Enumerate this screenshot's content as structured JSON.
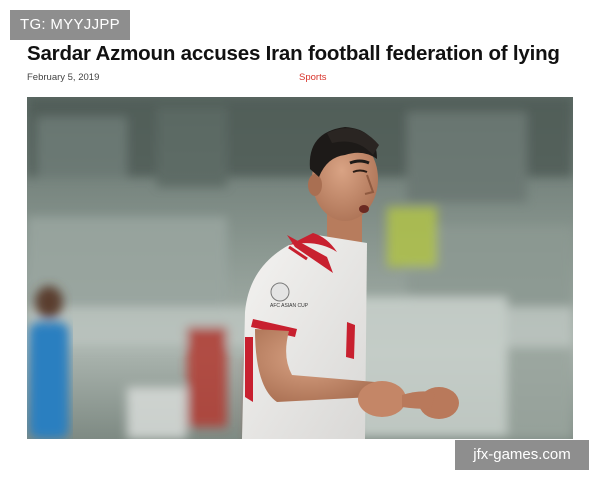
{
  "tag": "TG: MYYJJPP",
  "article": {
    "title": "Sardar Azmoun accuses Iran football federation of lying",
    "date": "February 5, 2019",
    "category": "Sports",
    "category_color": "#d8332b"
  },
  "photo": {
    "badge_text": "AFC ASIAN CUP"
  },
  "watermark": "jfx-games.com"
}
